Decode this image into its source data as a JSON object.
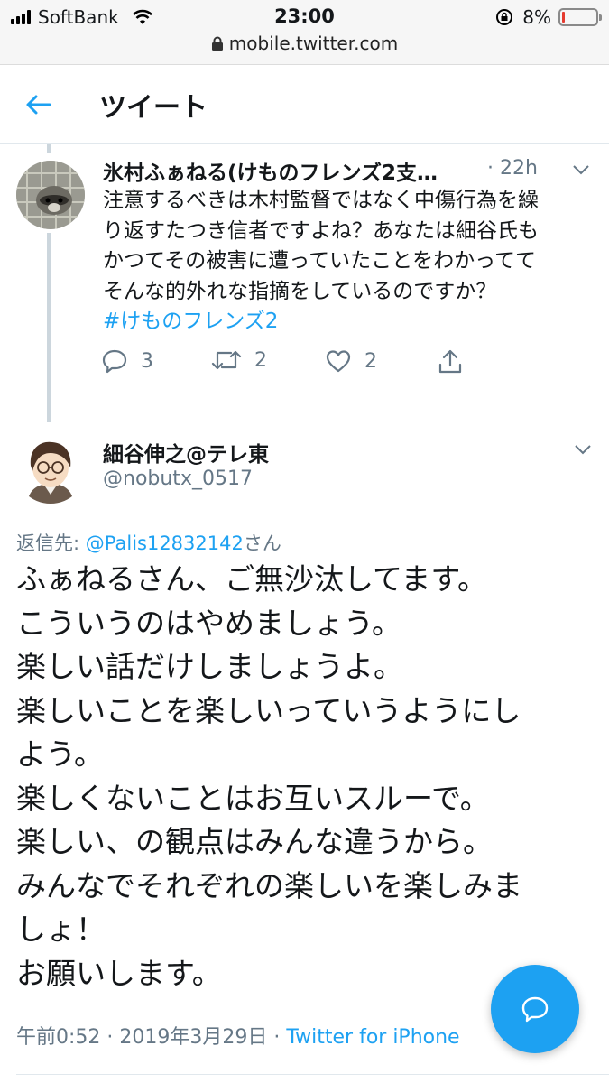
{
  "status_bar": {
    "carrier": "SoftBank",
    "time": "23:00",
    "battery_percent_label": "8%",
    "battery_level": 0.08,
    "battery_color": "#e53b30",
    "url": "mobile.twitter.com"
  },
  "header": {
    "title": "ツイート",
    "back_icon": "arrow-left-icon"
  },
  "parent_tweet": {
    "author_name": "氷村ふぁねる(けものフレンズ2支…",
    "time": "22h",
    "text_lines": [
      "注意するべきは木村監督ではなく中傷行為を繰",
      "り返すたつき信者ですよね？あなたは細谷氏も",
      "かつてその被害に遭っていたことをわかってて",
      "そんな的外れな指摘をしているのですか？"
    ],
    "hashtag": "#けものフレンズ2",
    "actions": {
      "reply_count": "3",
      "retweet_count": "2",
      "like_count": "2"
    }
  },
  "main_tweet": {
    "author_name": "細谷伸之@テレ東",
    "handle": "@nobutx_0517",
    "reply_prefix": "返信先: ",
    "reply_mention": "@Palis12832142",
    "reply_suffix": "さん",
    "text_lines": [
      "ふぁねるさん、ご無沙汰してます。",
      "こういうのはやめましょう。",
      "楽しい話だけしましょうよ。",
      "楽しいことを楽しいっていうようにし",
      "よう。",
      "楽しくないことはお互いスルーで。",
      "楽しい、の観点はみんな違うから。",
      "みんなでそれぞれの楽しいを楽しみま",
      "しょ！",
      "お願いします。"
    ],
    "meta_time": "午前0:52 · 2019年3月29日 · ",
    "meta_source": "Twitter for iPhone"
  },
  "colors": {
    "accent": "#1da1f2",
    "secondary_text": "#657786",
    "primary_text": "#14171a",
    "divider": "#e1e8ed"
  },
  "fab": {
    "icon": "compose-reply-icon"
  }
}
